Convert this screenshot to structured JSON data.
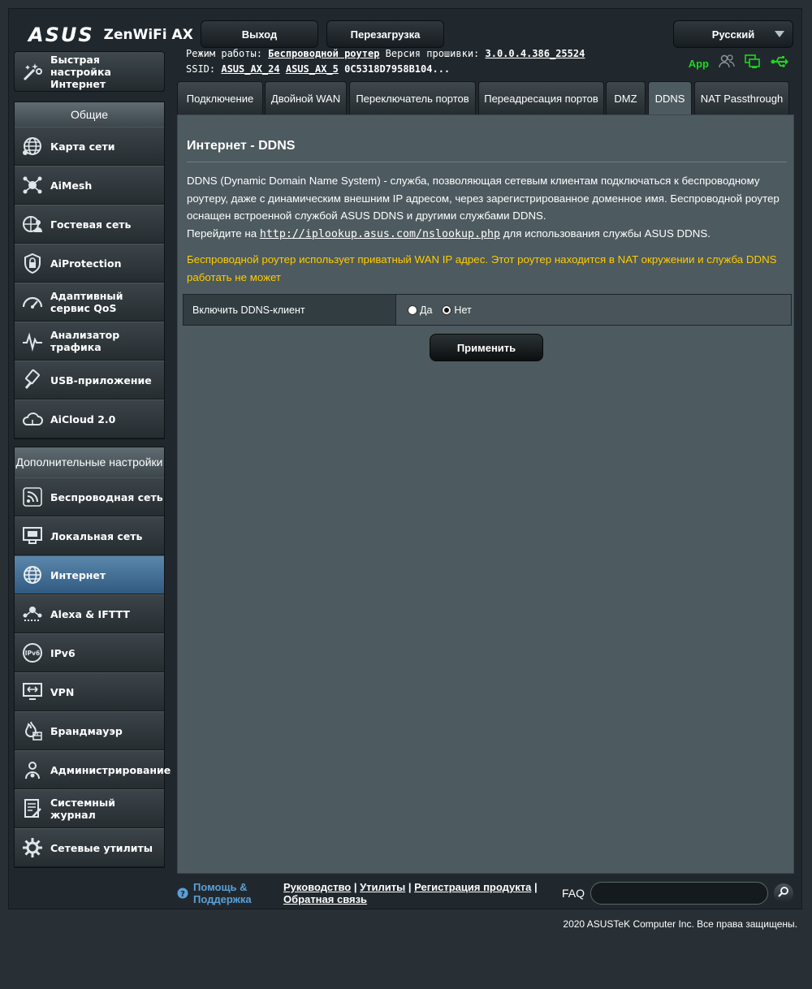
{
  "header": {
    "brand": "ASUS",
    "model": "ZenWiFi AX",
    "logout_label": "Выход",
    "reboot_label": "Перезагрузка",
    "language": "Русский"
  },
  "info": {
    "mode_label": "Режим работы:",
    "mode_value": "Беспроводной роутер",
    "firmware_label": "Версия прошивки:",
    "firmware_value": "3.0.0.4.386_25524",
    "ssid_label": "SSID:",
    "ssid_1": "ASUS_AX_24",
    "ssid_2": "ASUS_AX_5",
    "mac": "0C5318D7958B104..."
  },
  "status": {
    "app_label": "App",
    "colors": {
      "green": "#1ed61e",
      "grey": "#8b959a"
    }
  },
  "sidebar": {
    "quick_setup": "Быстрая настройка Интернет",
    "general_title": "Общие",
    "general_items": [
      {
        "label": "Карта сети",
        "icon": "globe-network-icon"
      },
      {
        "label": "AiMesh",
        "icon": "aimesh-icon"
      },
      {
        "label": "Гостевая сеть",
        "icon": "guest-network-icon"
      },
      {
        "label": "AiProtection",
        "icon": "shield-lock-icon"
      },
      {
        "label": "Адаптивный сервис QoS",
        "icon": "speedometer-icon"
      },
      {
        "label": "Анализатор трафика",
        "icon": "traffic-analyzer-icon"
      },
      {
        "label": "USB-приложение",
        "icon": "usb-icon"
      },
      {
        "label": "AiCloud 2.0",
        "icon": "cloud-icon"
      }
    ],
    "advanced_title": "Дополнительные настройки",
    "advanced_items": [
      {
        "label": "Беспроводная сеть",
        "icon": "wifi-icon"
      },
      {
        "label": "Локальная сеть",
        "icon": "lan-icon"
      },
      {
        "label": "Интернет",
        "icon": "globe-icon"
      },
      {
        "label": "Alexa & IFTTT",
        "icon": "alexa-icon"
      },
      {
        "label": "IPv6",
        "icon": "ipv6-icon"
      },
      {
        "label": "VPN",
        "icon": "vpn-icon"
      },
      {
        "label": "Брандмауэр",
        "icon": "firewall-icon"
      },
      {
        "label": "Администрирование",
        "icon": "admin-gear-icon"
      },
      {
        "label": "Системный журнал",
        "icon": "system-log-icon"
      },
      {
        "label": "Сетевые утилиты",
        "icon": "network-tools-icon"
      }
    ]
  },
  "tabs": [
    {
      "label": "Подключение"
    },
    {
      "label": "Двойной WAN"
    },
    {
      "label": "Переключатель портов"
    },
    {
      "label": "Переадресация портов"
    },
    {
      "label": "DMZ"
    },
    {
      "label": "DDNS"
    },
    {
      "label": "NAT Passthrough"
    }
  ],
  "main": {
    "title": "Интернет - DDNS",
    "desc_1": "DDNS (Dynamic Domain Name System) - служба, позволяющая сетевым клиентам подключаться к беспроводному роутеру, даже с динамическим внешним IP адресом, через зарегистрированное доменное имя. Беспроводной роутер оснащен встроенной службой ASUS DDNS и другими службами DDNS.",
    "desc_2_prefix": "Перейдите на",
    "desc_2_link": "http://iplookup.asus.com/nslookup.php",
    "desc_2_suffix": "для использования службы ASUS DDNS.",
    "warning": "Беспроводной роутер использует приватный WAN IP адрес. Этот роутер находится в NAT окружении и служба DDNS работать не может",
    "ddns_label": "Включить DDNS-клиент",
    "yes_label": "Да",
    "no_label": "Нет",
    "apply_label": "Применить"
  },
  "footer": {
    "help_label": "Помощь & Поддержка",
    "manual": "Руководство",
    "utilities": "Утилиты",
    "register": "Регистрация продукта",
    "feedback": "Обратная связь",
    "faq": "FAQ",
    "copyright": "2020 ASUSTeK Computer Inc. Все права защищены."
  }
}
